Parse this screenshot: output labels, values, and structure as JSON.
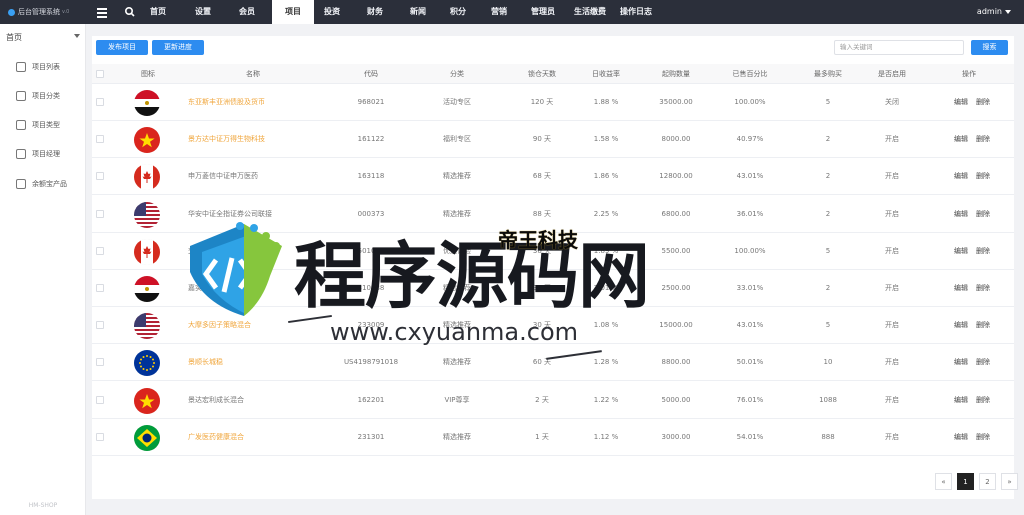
{
  "brand": {
    "title": "后台管理系统",
    "sub": "v.0"
  },
  "nav": [
    {
      "label": "首页",
      "active": false
    },
    {
      "label": "设置",
      "active": false
    },
    {
      "label": "会员",
      "active": false
    },
    {
      "label": "项目",
      "active": true
    },
    {
      "label": "投资",
      "active": false
    },
    {
      "label": "财务",
      "active": false
    },
    {
      "label": "新闻",
      "active": false
    },
    {
      "label": "积分",
      "active": false
    },
    {
      "label": "营销",
      "active": false
    },
    {
      "label": "管理员",
      "active": false
    },
    {
      "label": "生活缴费",
      "active": false
    },
    {
      "label": "操作日志",
      "active": false
    }
  ],
  "user": {
    "name": "admin"
  },
  "sidebar": {
    "home": "首页",
    "items": [
      {
        "label": "项目列表",
        "icon": "grid-icon"
      },
      {
        "label": "项目分类",
        "icon": "crown-icon"
      },
      {
        "label": "项目类型",
        "icon": "tag-icon"
      },
      {
        "label": "项目经理",
        "icon": "bookmark-icon"
      },
      {
        "label": "余额宝产品",
        "icon": "bookmark-icon"
      }
    ],
    "footer": "HM-SHOP"
  },
  "toolbar": {
    "publish_label": "发布项目",
    "refresh_label": "更新进度",
    "search_placeholder": "输入关键词",
    "search_label": "搜索"
  },
  "table": {
    "columns": [
      "图标",
      "名称",
      "代码",
      "分类",
      "锁仓天数",
      "日收益率",
      "起购数量",
      "已售百分比",
      "最多购买",
      "是否启用",
      "操作"
    ],
    "rows": [
      {
        "flag": "egypt",
        "name": "东亚斯丰亚洲债股及货币",
        "name_link": true,
        "code": "968021",
        "category": "活动专区",
        "days": "120 天",
        "rate": "1.88 %",
        "min": "35000.00",
        "sold": "100.00%",
        "max": "5",
        "enabled": "关闭"
      },
      {
        "flag": "vietnam",
        "name": "景方达中证万得生物科技",
        "name_link": true,
        "code": "161122",
        "category": "福利专区",
        "days": "90 天",
        "rate": "1.58 %",
        "min": "8000.00",
        "sold": "40.97%",
        "max": "2",
        "enabled": "开启"
      },
      {
        "flag": "canada",
        "name": "申万菱信中证申万医药",
        "name_link": false,
        "code": "163118",
        "category": "精选推荐",
        "days": "68 天",
        "rate": "1.86 %",
        "min": "12800.00",
        "sold": "43.01%",
        "max": "2",
        "enabled": "开启"
      },
      {
        "flag": "usa",
        "name": "华安中证全指证券公司联接",
        "name_link": false,
        "code": "000373",
        "category": "精选推荐",
        "days": "88 天",
        "rate": "2.25 %",
        "min": "6800.00",
        "sold": "36.01%",
        "max": "2",
        "enabled": "开启"
      },
      {
        "flag": "canada",
        "name": "交银施罗德优选价值",
        "name_link": false,
        "code": "501011",
        "category": "优选体验",
        "days": "30 天",
        "rate": "1.89 %",
        "min": "5500.00",
        "sold": "100.00%",
        "max": "5",
        "enabled": "开启"
      },
      {
        "flag": "egypt",
        "name": "嘉实新兴产业股票",
        "name_link": false,
        "code": "310388",
        "category": "精选推荐",
        "days": "30 天",
        "rate": "2.01 %",
        "min": "2500.00",
        "sold": "33.01%",
        "max": "2",
        "enabled": "开启"
      },
      {
        "flag": "usa",
        "name": "大摩多因子策略混合",
        "name_link": true,
        "code": "233009",
        "category": "精选推荐",
        "days": "30 天",
        "rate": "1.08 %",
        "min": "15000.00",
        "sold": "43.01%",
        "max": "5",
        "enabled": "开启"
      },
      {
        "flag": "eu",
        "name": "景顺长城稳",
        "name_link": true,
        "code": "US4198791018",
        "category": "精选推荐",
        "days": "60 天",
        "rate": "1.28 %",
        "min": "8800.00",
        "sold": "50.01%",
        "max": "10",
        "enabled": "开启"
      },
      {
        "flag": "vietnam",
        "name": "景达宏利成长混合",
        "name_link": false,
        "code": "162201",
        "category": "VIP尊享",
        "days": "2 天",
        "rate": "1.22 %",
        "min": "5000.00",
        "sold": "76.01%",
        "max": "1088",
        "enabled": "开启"
      },
      {
        "flag": "brazil",
        "name": "广发医药健康混合",
        "name_link": true,
        "code": "231301",
        "category": "精选推荐",
        "days": "1 天",
        "rate": "1.12 %",
        "min": "3000.00",
        "sold": "54.01%",
        "max": "888",
        "enabled": "开启"
      }
    ],
    "edit_label": "编辑",
    "delete_label": "删除"
  },
  "pagination": {
    "prev": "«",
    "pages": [
      "1",
      "2"
    ],
    "next": "»",
    "current": "1"
  },
  "watermark": {
    "title": "程序源码网",
    "url": "www.cxyuanma.com",
    "badge": "帝王科技"
  },
  "colors": {
    "topbar": "#2b2f3a",
    "primary": "#2d8cf0",
    "link": "#f0a63c"
  }
}
